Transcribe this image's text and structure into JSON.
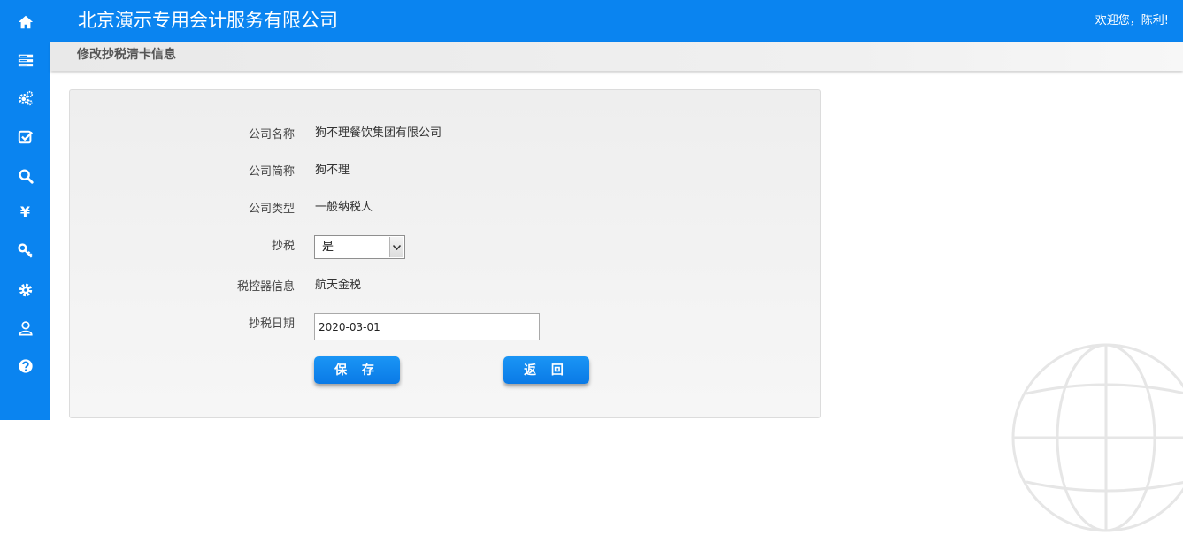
{
  "header": {
    "company_name": "北京演示专用会计服务有限公司",
    "welcome_text": "欢迎您，陈利!"
  },
  "sidebar": {
    "items": [
      {
        "icon": "home-icon"
      },
      {
        "icon": "list-icon"
      },
      {
        "icon": "gears-icon"
      },
      {
        "icon": "check-square-icon"
      },
      {
        "icon": "search-icon"
      },
      {
        "icon": "yen-icon",
        "glyph": "¥"
      },
      {
        "icon": "key-icon"
      },
      {
        "icon": "gear-icon"
      },
      {
        "icon": "user-icon"
      },
      {
        "icon": "help-icon"
      }
    ]
  },
  "page": {
    "title": "修改抄税清卡信息"
  },
  "form": {
    "company_name_label": "公司名称",
    "company_name_value": "狗不理餐饮集团有限公司",
    "company_short_label": "公司简称",
    "company_short_value": "狗不理",
    "company_type_label": "公司类型",
    "company_type_value": "一般纳税人",
    "copy_tax_label": "抄税",
    "copy_tax_selected": "是",
    "tax_controller_label": "税控器信息",
    "tax_controller_value": "航天金税",
    "copy_tax_date_label": "抄税日期",
    "copy_tax_date_value": "2020-03-01",
    "save_label": "保 存",
    "back_label": "返 回"
  },
  "colors": {
    "brand": "#0a84f0",
    "button": "#0a7ae6"
  }
}
